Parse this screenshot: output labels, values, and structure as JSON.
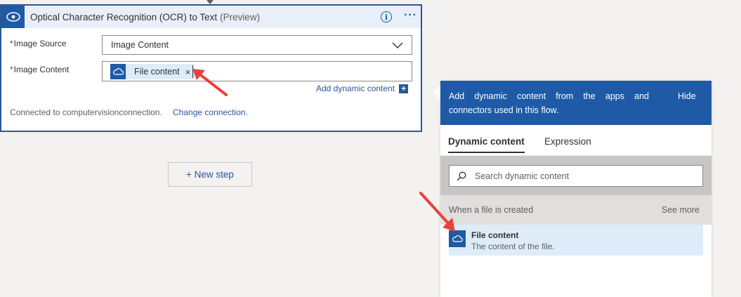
{
  "action_card": {
    "title": "Optical Character Recognition (OCR) to Text",
    "title_suffix": "(Preview)",
    "info_icon": "info-icon",
    "more_icon": "ellipsis-icon",
    "fields": [
      {
        "label": "Image Source",
        "required_mark": "*",
        "value": "Image Content"
      },
      {
        "label": "Image Content",
        "required_mark": "*",
        "token": "File content",
        "token_remove": "×"
      }
    ],
    "add_dynamic_content": "Add dynamic content",
    "connection_text": "Connected to computervisionconnection.",
    "change_connection": "Change connection."
  },
  "new_step": "+ New step",
  "dynamic_panel": {
    "description_line1": "Add dynamic content from the apps and",
    "description_line2": "connectors used in this flow.",
    "hide": "Hide",
    "tabs": [
      "Dynamic content",
      "Expression"
    ],
    "search_placeholder": "Search dynamic content",
    "section_title": "When a file is created",
    "see_more": "See more",
    "items": [
      {
        "title": "File content",
        "description": "The content of the file.",
        "icon": "onedrive-cloud-icon"
      }
    ]
  },
  "colors": {
    "primary": "#1f5aa6",
    "link": "#2b579a",
    "annotation_arrow": "#e8413c",
    "token_bg": "#deecf9"
  }
}
